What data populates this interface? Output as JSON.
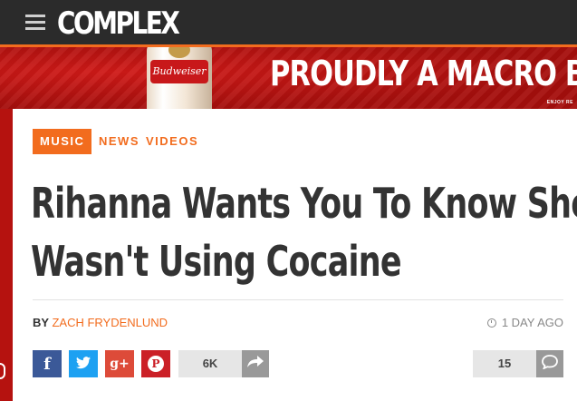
{
  "nav": {
    "logo": "COMPLEX"
  },
  "ad": {
    "bottle_label": "Budweiser",
    "headline": "PROUDLY A MACRO BEE",
    "fine_print": "ENJOY RE"
  },
  "article": {
    "tags": {
      "primary": "MUSIC",
      "secondary": [
        "NEWS",
        "VIDEOS"
      ]
    },
    "headline_line1": "Rihanna Wants You To Know She",
    "headline_line2": "Wasn't Using Cocaine",
    "byline_prefix": "BY",
    "author": "ZACH FRYDENLUND",
    "timestamp": "1 DAY AGO",
    "share_count": "6K",
    "comment_count": "15"
  },
  "social": {
    "facebook_glyph": "f",
    "twitter_glyph": "t",
    "googleplus_glyph": "g+",
    "pinterest_glyph": "P"
  },
  "colors": {
    "accent": "#f26c1e",
    "topbar": "#2b2b2b",
    "ad_red": "#b5120f",
    "facebook": "#3b5998",
    "twitter": "#1da1f2",
    "googleplus": "#dd4b39",
    "pinterest": "#cb2027"
  }
}
